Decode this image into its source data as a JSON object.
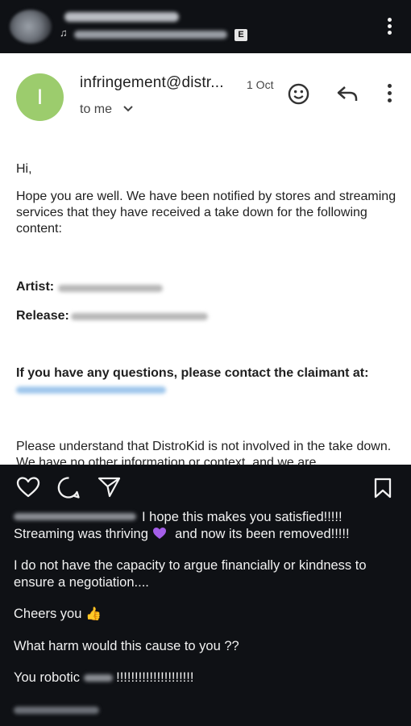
{
  "post_header": {
    "badge": "E",
    "audio_icon": "music-note-icon",
    "more_icon": "more-vertical-icon"
  },
  "email": {
    "avatar_letter": "I",
    "sender": "infringement@distr...",
    "date": "1 Oct",
    "recipient": "to me",
    "greeting": "Hi,",
    "paragraph1": "Hope you are well. We have been notified by stores and streaming services that they have received a take down for the following content:",
    "artist_label": "Artist:",
    "release_label": "Release:",
    "questions": "If you have any questions, please contact the claimant at:",
    "paragraph_last": "Please understand that DistroKid is not involved in the take down. We have no other information or context, and we are",
    "colors": {
      "avatar": "#9ccc6d",
      "link": "#9fc7ec"
    }
  },
  "caption": {
    "line1_text": "I hope this makes you satisfied!!!!!",
    "line2_a": "Streaming was thriving",
    "line2_b": "and now its been removed!!!!!",
    "para2": "I do not have the capacity to argue financially or kindness to ensure a negotiation....",
    "para3": "Cheers you",
    "para4": "What harm would this cause to you ??",
    "para5_a": "You robotic",
    "para5_b": "!!!!!!!!!!!!!!!!!!!!!",
    "emoji_heart": "purple-heart-icon",
    "emoji_thumb": "👍"
  }
}
